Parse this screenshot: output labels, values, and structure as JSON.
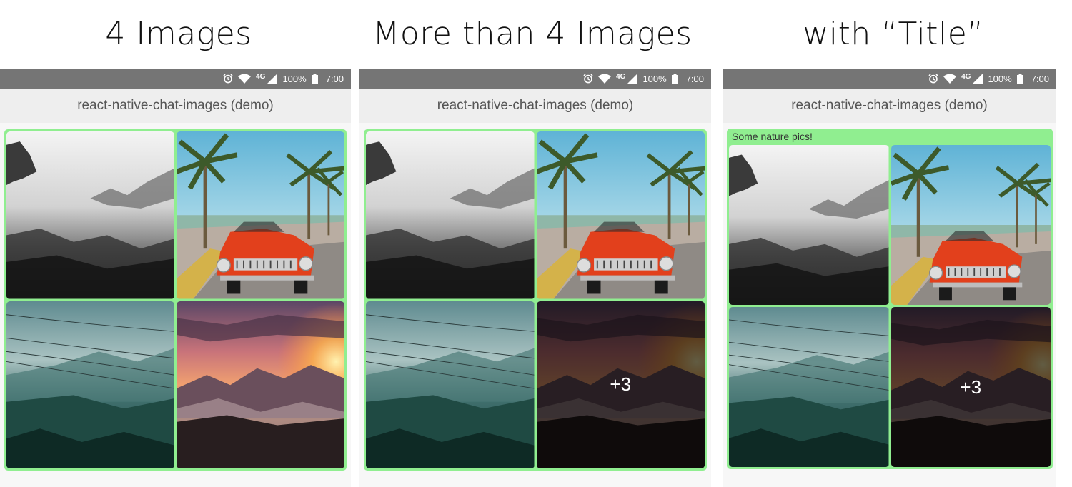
{
  "headings": [
    "4 Images",
    "More than 4 Images",
    "with “Title”"
  ],
  "status_bar": {
    "network": "4G",
    "battery": "100%",
    "time": "7:00"
  },
  "app_title": "react-native-chat-images (demo)",
  "bubble_title": "Some nature pics!",
  "more_overlay": "+3",
  "colors": {
    "bubble": "#90ee90",
    "status_bar": "#757575",
    "app_bar": "#eeeeee"
  },
  "image_subjects": [
    "foggy-mountain",
    "red-car-palms",
    "misty-valley",
    "sunset-mountains"
  ]
}
